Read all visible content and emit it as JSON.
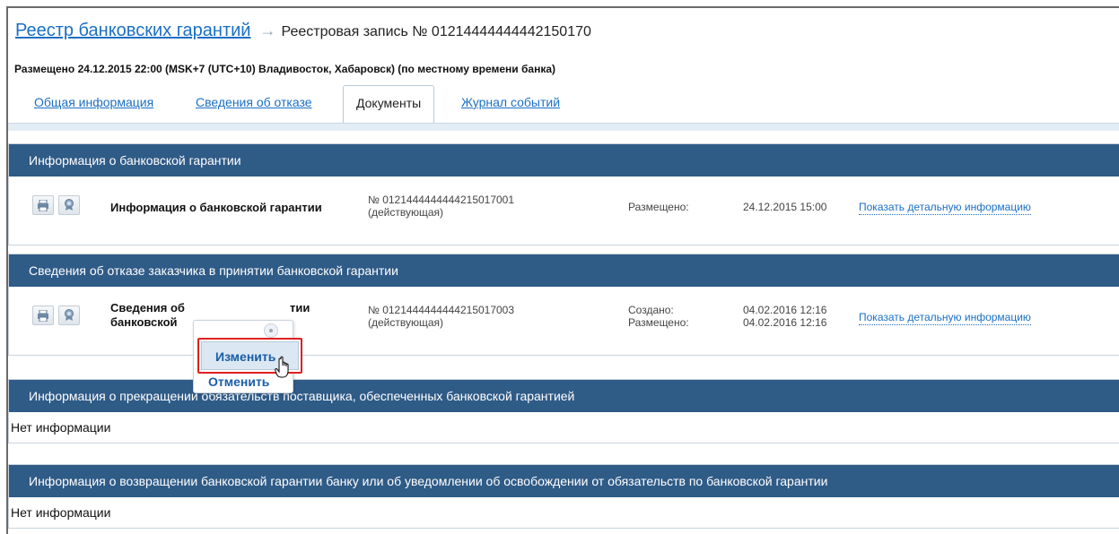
{
  "header": {
    "breadcrumb_link": "Реестр банковских гарантий",
    "arrow": "→",
    "current": "Реестровая запись № 01214444444442150170"
  },
  "placed_line": "Размещено 24.12.2015 22:00 (MSK+7 (UTC+10) Владивосток, Хабаровск) (по местному времени банка)",
  "tabs": [
    {
      "label": "Общая информация",
      "active": false
    },
    {
      "label": "Сведения об отказе",
      "active": false
    },
    {
      "label": "Документы",
      "active": true
    },
    {
      "label": "Журнал событий",
      "active": false
    }
  ],
  "sections": {
    "guarantee": {
      "title": "Информация о банковской гарантии",
      "row": {
        "name": "Информация о банковской гарантии",
        "number": "№ 0121444444444215017001",
        "status": "(действующая)",
        "label1": "Размещено:",
        "date1": "24.12.2015 15:00",
        "detail_link": "Показать детальную информацию"
      }
    },
    "refusal": {
      "title": "Сведения об отказе заказчика в принятии банковской гарантии",
      "row": {
        "name_line1": "Сведения об",
        "name_line1_tail": "тии",
        "name_line2": "банковской",
        "number": "№ 0121444444444215017003",
        "status": "(действующая)",
        "label1": "Создано:",
        "label2": "Размещено:",
        "date1": "04.02.2016 12:16",
        "date2": "04.02.2016 12:16",
        "detail_link": "Показать детальную информацию"
      }
    },
    "termination": {
      "title": "Информация о прекращении обязательств поставщика, обеспеченных банковской гарантией",
      "empty_text": "Нет информации"
    },
    "return": {
      "title": "Информация о возвращении банковской гарантии банку или об уведомлении об освобождении от обязательств по банковской гарантии",
      "empty_text": "Нет информации"
    }
  },
  "context_menu": {
    "edit_label": "Изменить",
    "cancel_label": "Отменить"
  },
  "colors": {
    "section_header": "#2f5b87",
    "link": "#1a6fc4",
    "highlight_border": "#e02020"
  }
}
